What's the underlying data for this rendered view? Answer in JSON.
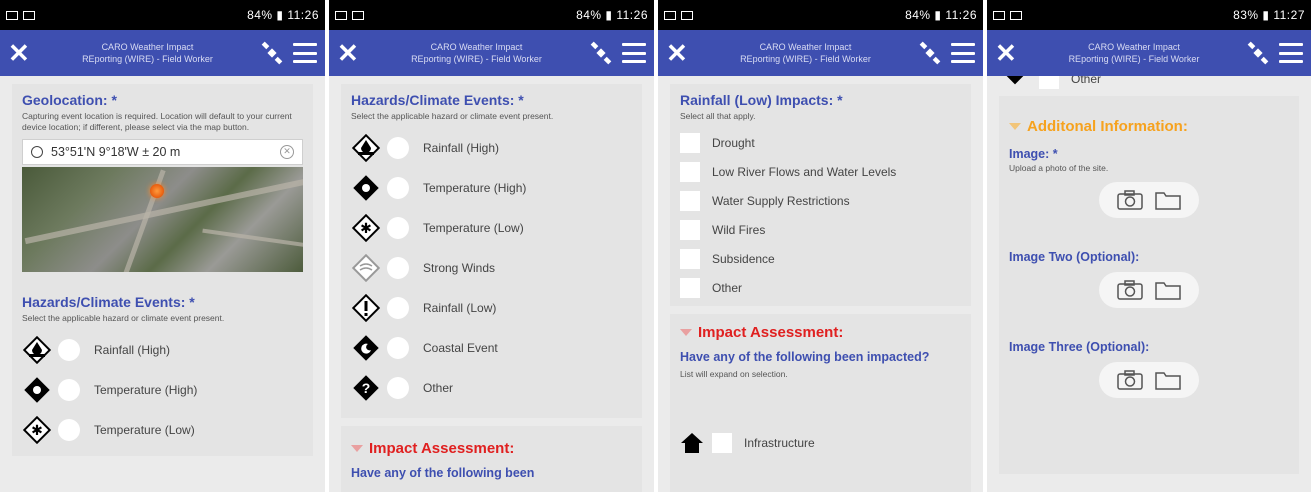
{
  "app": {
    "title_line1": "CARO Weather Impact",
    "title_line2": "REporting (WIRE) - Field Worker"
  },
  "screens": [
    {
      "status_time": "84% ▮ 11:26",
      "geolocation": {
        "label": "Geolocation: *",
        "hint": "Capturing event location is required. Location will default to your current device location; if different, please select via the map button.",
        "value": "53°51'N 9°18'W ± 20 m"
      },
      "hazards": {
        "label": "Hazards/Climate Events: *",
        "hint": "Select the applicable hazard or climate event present.",
        "options": [
          "Rainfall (High)",
          "Temperature (High)",
          "Temperature (Low)"
        ]
      }
    },
    {
      "status_time": "84% ▮ 11:26",
      "hazards": {
        "label": "Hazards/Climate Events: *",
        "hint": "Select the applicable hazard or climate event present.",
        "options": [
          "Rainfall (High)",
          "Temperature (High)",
          "Temperature (Low)",
          "Strong Winds",
          "Rainfall (Low)",
          "Coastal Event",
          "Other"
        ]
      },
      "impact": {
        "heading": "Impact Assessment:",
        "question": "Have any of the following been"
      }
    },
    {
      "status_time": "84% ▮ 11:26",
      "rainfall_low": {
        "label": "Rainfall (Low) Impacts: *",
        "hint": "Select all that apply.",
        "options": [
          "Drought",
          "Low River Flows and Water Levels",
          "Water Supply Restrictions",
          "Wild Fires",
          "Subsidence",
          "Other"
        ]
      },
      "impact": {
        "heading": "Impact Assessment:",
        "question": "Have any of the following been impacted?",
        "hint": "List will expand on selection.",
        "first_item": "Infrastructure"
      }
    },
    {
      "status_time": "83% ▮ 11:27",
      "top_item": "Other",
      "additional": {
        "heading": "Additonal Information:",
        "image1_label": "Image: *",
        "image1_hint": "Upload a photo of the site.",
        "image2_label": "Image Two (Optional):",
        "image3_label": "Image Three (Optional):"
      }
    }
  ]
}
